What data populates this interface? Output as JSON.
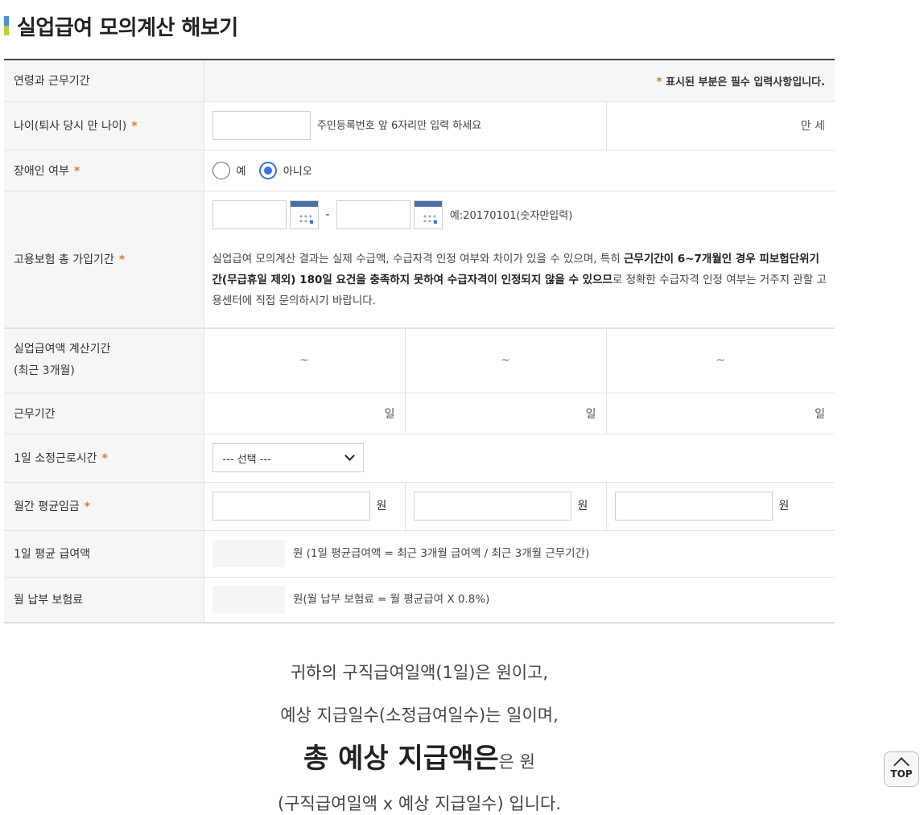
{
  "title": "실업급여 모의계산 해보기",
  "header_row": {
    "label": "연령과 근무기간",
    "required_star": "*",
    "required_note": "표시된 부분은 필수 입력사항입니다."
  },
  "age": {
    "label": "나이(퇴사 당시 만 나이)",
    "input_value": "",
    "hint": "주민등록번호 앞 6자리만 입력 하세요",
    "unit": "만 세"
  },
  "disability": {
    "label": "장애인 여부",
    "options": [
      "예",
      "아니오"
    ],
    "selected": "아니오"
  },
  "insurance_period": {
    "label": "고용보험 총 가입기간",
    "start_value": "",
    "end_value": "",
    "separator": "-",
    "example": "예:20170101(숫자만입력)",
    "notice_1": "실업급여 모의계산 결과는 실제 수급액, 수급자격 인정 여부와 차이가 있을 수 있으며, 특히 ",
    "notice_bold": "근무기간이 6~7개월인 경우 피보험단위기간(무급휴일 제외) 180일 요건을 충족하지 못하여 수급자격이 인정되지 않을 수 있으므",
    "notice_2": "로 정확한 수급자격 인정 여부는 거주지 관할 고용센터에 직접 문의하시기 바랍니다."
  },
  "calc_period": {
    "label_line1": "실업급여액 계산기간",
    "label_line2": "(최근 3개월)",
    "cols": [
      "~",
      "~",
      "~"
    ]
  },
  "work_days": {
    "label": "근무기간",
    "cols": [
      "일",
      "일",
      "일"
    ]
  },
  "daily_hours": {
    "label": "1일 소정근로시간",
    "selected": "--- 선택 ---"
  },
  "monthly_wage": {
    "label": "월간 평균임금",
    "values": [
      "",
      "",
      ""
    ],
    "unit": "원"
  },
  "daily_benefit": {
    "label": "1일 평균 급여액",
    "formula": "원 (1일 평균급여액 = 최근 3개월 급여액 / 최근 3개월 근무기간)"
  },
  "monthly_premium": {
    "label": "월 납부 보험료",
    "formula": "원(월 납부 보험료 = 월 평균급여 X 0.8%)"
  },
  "result": {
    "line1": "귀하의 구직급여일액(1일)은 원이고,",
    "line2": "예상 지급일수(소정급여일수)는 일이며,",
    "line3_big": "총 예상 지급액은",
    "line3_rest": "은 원",
    "line4": "(구직급여일액 x 예상 지급일수) 입니다."
  },
  "top_button": "TOP",
  "colors": {
    "accent": "#3a6fe0",
    "required": "#e07a2b",
    "title_bar_top": "#4a90d9",
    "title_bar_bottom": "#b5d334"
  }
}
